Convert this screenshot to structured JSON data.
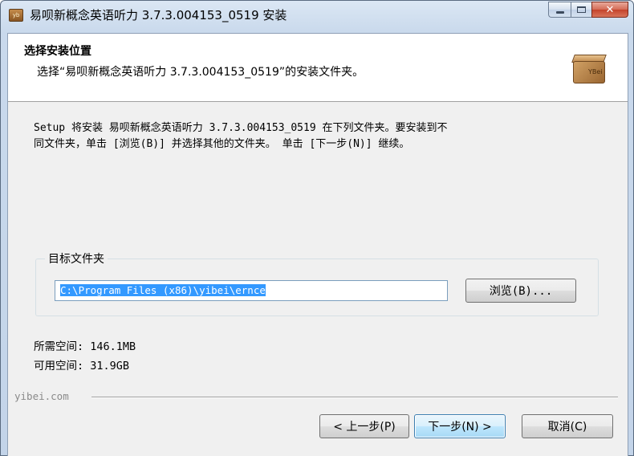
{
  "window": {
    "title": "易呗新概念英语听力 3.7.3.004153_0519 安装",
    "app_icon_text": "yb",
    "controls": {
      "minimize": "",
      "maximize": "",
      "close": "✕"
    }
  },
  "header": {
    "title": "选择安装位置",
    "subtitle": "选择“易呗新概念英语听力 3.7.3.004153_0519”的安装文件夹。",
    "logo_text": "YBei"
  },
  "description": {
    "line1": "Setup 将安装 易呗新概念英语听力 3.7.3.004153_0519 在下列文件夹。要安装到不",
    "line2": "同文件夹，单击 [浏览(B)] 并选择其他的文件夹。 单击 [下一步(N)] 继续。"
  },
  "destination": {
    "group_label": "目标文件夹",
    "path": "C:\\Program Files (x86)\\yibei\\ernce",
    "browse_label": "浏览(B)..."
  },
  "space": {
    "required": "所需空间: 146.1MB",
    "available": "可用空间: 31.9GB"
  },
  "brand": "yibei.com",
  "buttons": {
    "back": "< 上一步(P)",
    "next": "下一步(N) >",
    "cancel": "取消(C)"
  }
}
